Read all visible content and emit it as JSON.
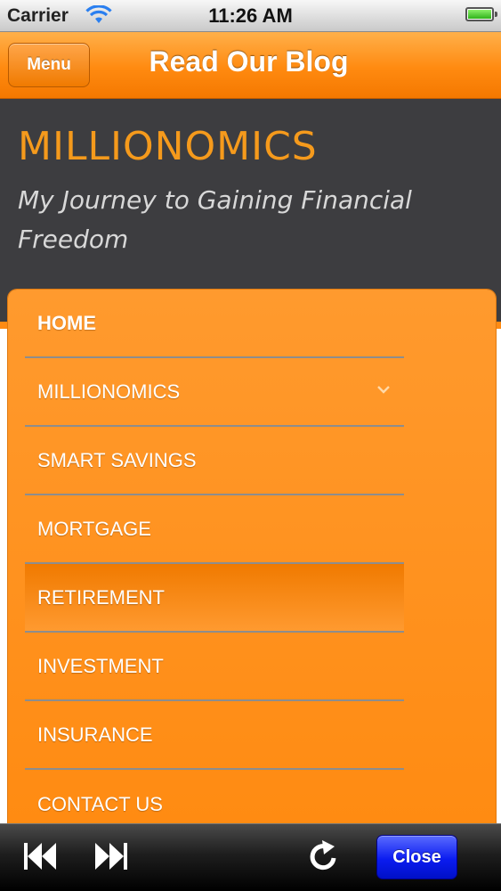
{
  "status_bar": {
    "carrier": "Carrier",
    "time": "11:26 AM"
  },
  "nav": {
    "menu_label": "Menu",
    "title": "Read Our Blog"
  },
  "header": {
    "site_title": "MILLIONOMICS",
    "tagline": "My Journey to Gaining Financial Freedom"
  },
  "menu": {
    "items": [
      {
        "label": "HOME"
      },
      {
        "label": "MILLIONOMICS"
      },
      {
        "label": "SMART SAVINGS"
      },
      {
        "label": "MORTGAGE"
      },
      {
        "label": "RETIREMENT"
      },
      {
        "label": "INVESTMENT"
      },
      {
        "label": "INSURANCE"
      },
      {
        "label": "CONTACT US"
      }
    ]
  },
  "toolbar": {
    "close_label": "Close",
    "icons": [
      "rewind-icon",
      "fast-forward-icon",
      "refresh-icon"
    ]
  },
  "colors": {
    "accent": "#ff8a10",
    "header_bg": "#3d3d40",
    "site_title": "#f59a1c",
    "close_button": "#0b1cf0"
  }
}
